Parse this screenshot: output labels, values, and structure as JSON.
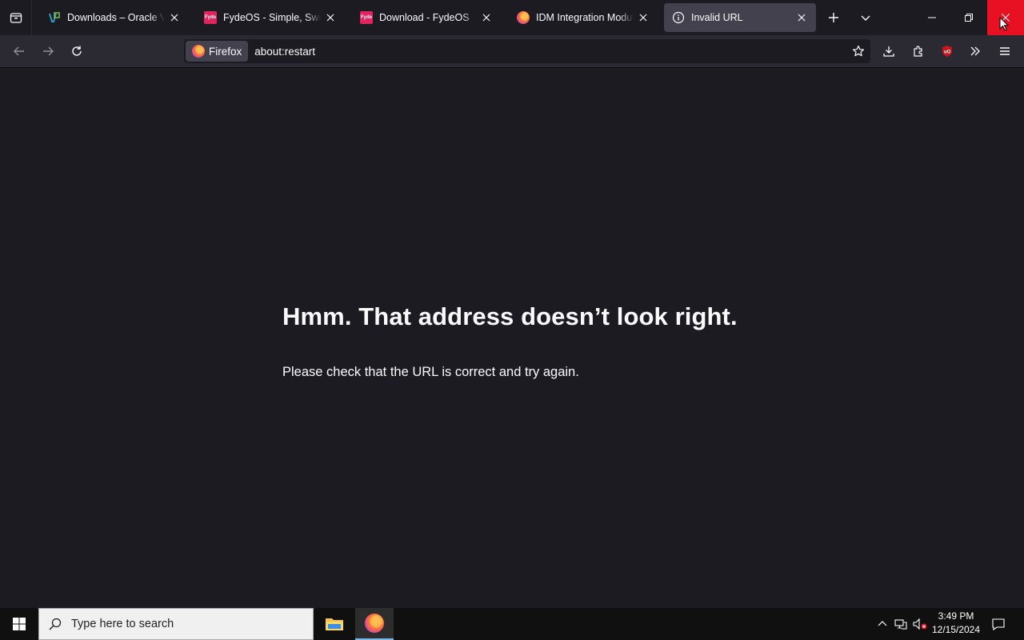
{
  "tabs": [
    {
      "title": "Downloads – Oracle VirtualBox",
      "favicon": "virtualbox-icon",
      "active": false
    },
    {
      "title": "FydeOS - Simple, Swift, and Secure",
      "favicon": "fydeos-icon",
      "active": false
    },
    {
      "title": "Download - FydeOS",
      "favicon": "fydeos-icon",
      "active": false
    },
    {
      "title": "IDM Integration Module – Firefox",
      "favicon": "firefox-icon",
      "active": false
    },
    {
      "title": "Invalid URL",
      "favicon": "info-icon",
      "active": true
    }
  ],
  "fyde_favicon_text": "Fyde",
  "urlbar": {
    "identity_label": "Firefox",
    "url": "about:restart"
  },
  "page": {
    "title": "Hmm. That address doesn’t look right.",
    "description": "Please check that the URL is correct and try again."
  },
  "taskbar": {
    "search_placeholder": "Type here to search",
    "time": "3:49 PM",
    "date": "12/15/2024"
  },
  "colors": {
    "page_bg": "#1c1b22",
    "toolbar_bg": "#2b2a33",
    "active_tab": "#42414d",
    "close_hover": "#e81123",
    "fydeos": "#e0245e"
  }
}
